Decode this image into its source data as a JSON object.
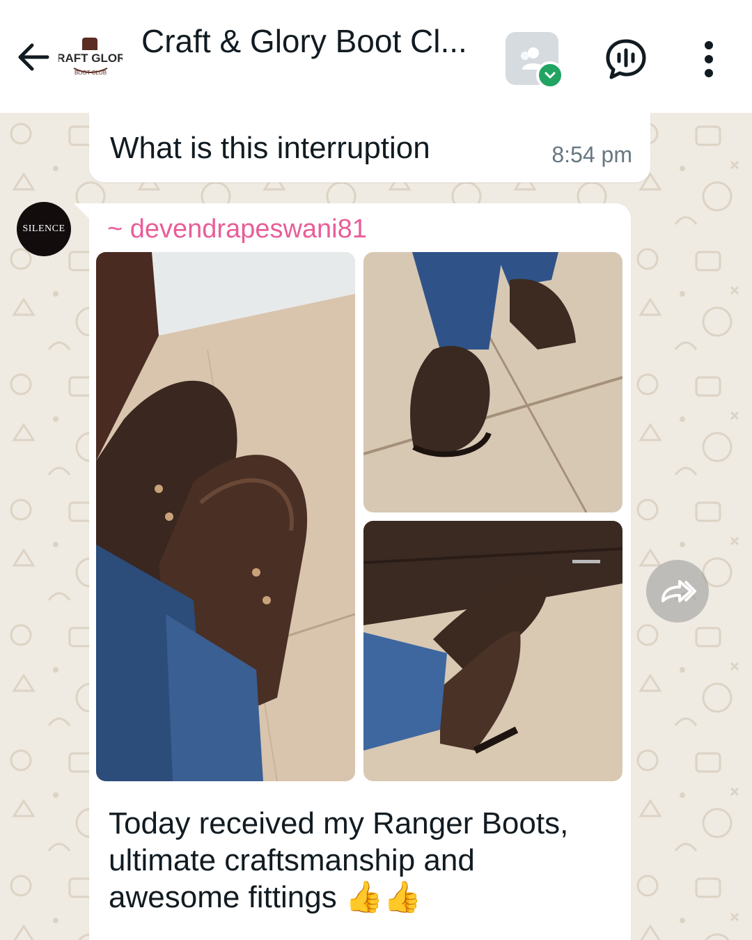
{
  "header": {
    "title": "Craft & Glory Boot Cl...",
    "logo_text": "CRAFT & GLORY BOOT CLUB",
    "back_icon": "arrow-left-icon",
    "community_icon": "community-icon",
    "voice_icon": "voice-chat-icon",
    "menu_icon": "more-vertical-icon"
  },
  "messages": {
    "previous": {
      "text": "What is this interruption",
      "time": "8:54 pm"
    },
    "current": {
      "avatar_text": "SILENCE",
      "sender": "~ devendrapeswani81",
      "photos": [
        "boots-photo-1",
        "boots-photo-2",
        "boots-photo-3"
      ],
      "caption": "Today received my Ranger Boots, ultimate craftsmanship and awesome fittings 👍👍"
    }
  },
  "colors": {
    "sender": "#e85e98",
    "background": "#efeae2",
    "accent": "#21a462"
  }
}
